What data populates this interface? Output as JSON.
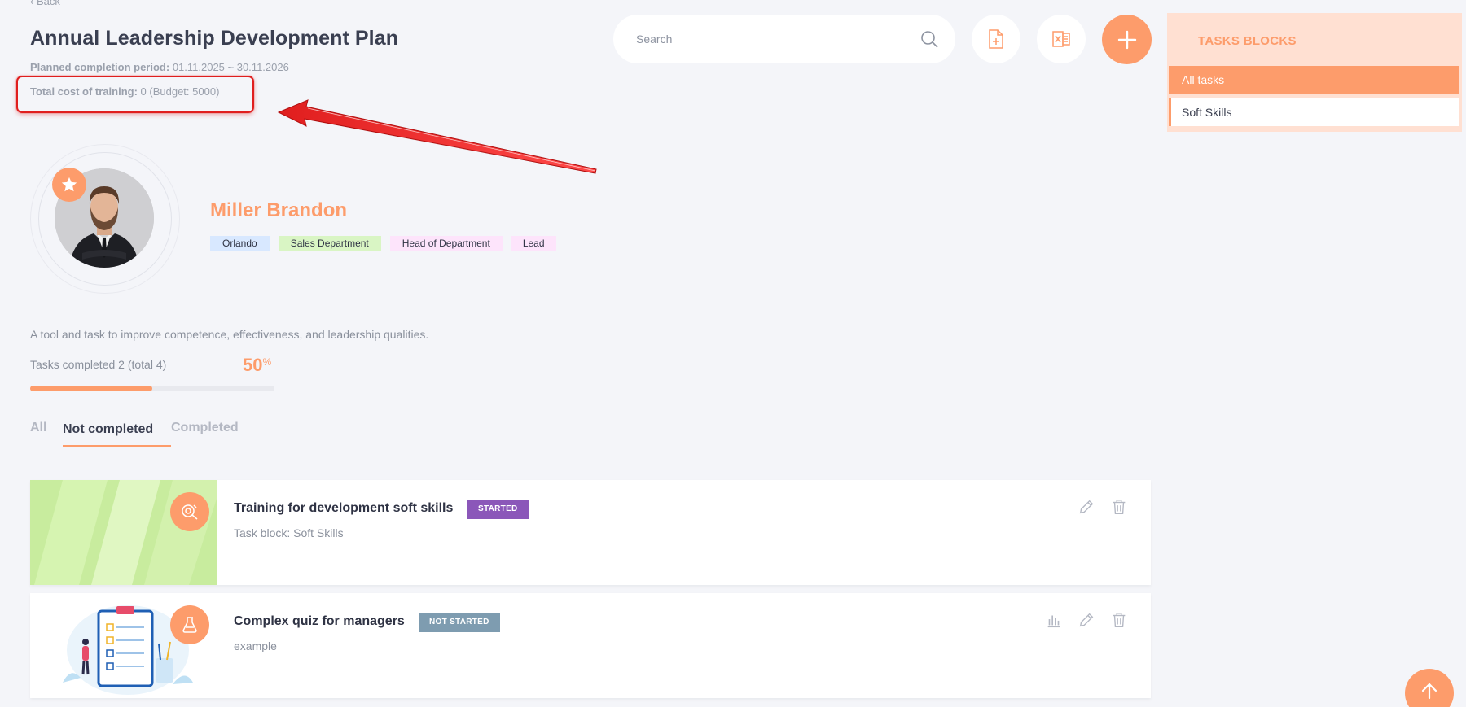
{
  "header": {
    "back_label": "‹ Back",
    "title": "Annual Leadership Development Plan",
    "period_label": "Planned completion period:",
    "period_value": "01.11.2025 ~ 30.11.2026",
    "cost_label": "Total cost of training:",
    "cost_value": "0 (Budget: 5000)"
  },
  "search": {
    "placeholder": "Search"
  },
  "toolbar": {
    "doc_icon": "add-document-icon",
    "excel_icon": "excel-export-icon",
    "add_icon": "plus-icon"
  },
  "side_panel": {
    "title": "TASKS BLOCKS",
    "items": [
      {
        "label": "All tasks",
        "active": true
      },
      {
        "label": "Soft Skills",
        "active": false
      }
    ]
  },
  "person": {
    "name": "Miller Brandon",
    "tags": [
      "Orlando",
      "Sales Department",
      "Head of Department",
      "Lead"
    ]
  },
  "plan": {
    "description": "A tool and task to improve competence, effectiveness, and leadership qualities.",
    "progress_label": "Tasks completed 2 (total 4)",
    "progress_percent": "50",
    "progress_unit": "%",
    "progress_fraction": 0.5
  },
  "tabs": [
    "All",
    "Not completed",
    "Completed"
  ],
  "active_tab": "Not completed",
  "tasks": [
    {
      "title": "Training for development soft skills",
      "status": "STARTED",
      "subtitle": "Task block: Soft Skills",
      "icon": "training-icon"
    },
    {
      "title": "Complex quiz for managers",
      "status": "NOT STARTED",
      "subtitle": "example",
      "icon": "quiz-flask-icon"
    }
  ],
  "colors": {
    "accent": "#fd9c6b",
    "started": "#8b57b9",
    "not_started": "#7e9cb0",
    "annotation": "#e01e1e"
  }
}
